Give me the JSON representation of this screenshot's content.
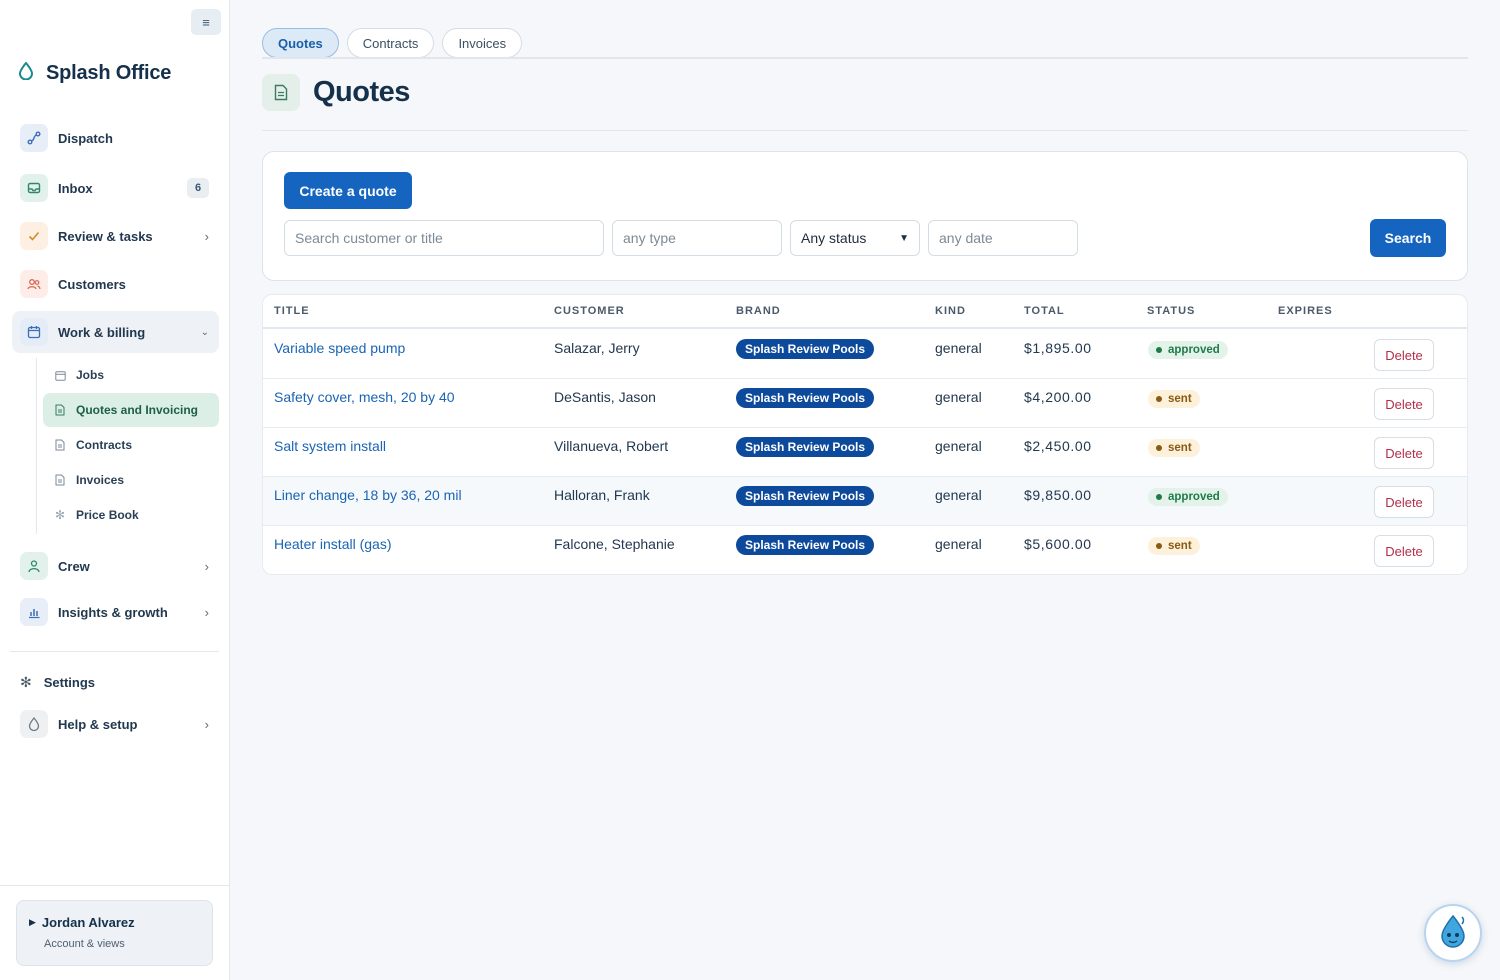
{
  "app": {
    "title": "Splash Office"
  },
  "sidebar": {
    "collapse_icon": "hamburger-icon",
    "nav": [
      {
        "label": "Dispatch",
        "icon": "route-icon",
        "color": "#e7eef7"
      },
      {
        "label": "Inbox",
        "icon": "inbox-icon",
        "badge": "6",
        "color": "#e3f1ec"
      },
      {
        "label": "Review & tasks",
        "icon": "check-icon",
        "color": "#fdf0e2"
      },
      {
        "label": "Customers",
        "icon": "users-icon",
        "color": "#fdece8"
      },
      {
        "label": "Work & billing",
        "icon": "calendar-icon",
        "color": "#e3ecf7"
      },
      {
        "label": "Crew",
        "icon": "person-icon",
        "color": "#e3f1ec"
      },
      {
        "label": "Insights & growth",
        "icon": "chart-icon",
        "color": "#e7eef7"
      },
      {
        "label": "Help & setup",
        "icon": "droplet-icon",
        "color": "#eef0f2"
      }
    ],
    "sub": [
      {
        "label": "Jobs",
        "icon": "calendar-icon"
      },
      {
        "label": "Quotes and Invoicing",
        "icon": "document-icon"
      },
      {
        "label": "Contracts",
        "icon": "document-icon"
      },
      {
        "label": "Invoices",
        "icon": "document-icon"
      },
      {
        "label": "Price Book",
        "icon": "gear-icon"
      }
    ],
    "settings": {
      "label": "Settings",
      "icon": "gear-icon"
    },
    "user": {
      "name": "Jordan Alvarez",
      "subtitle": "Account & views"
    }
  },
  "tabs": [
    "Quotes",
    "Contracts",
    "Invoices"
  ],
  "page": {
    "title": "Quotes",
    "icon": "document-icon"
  },
  "filters": {
    "create_label": "Create a quote",
    "search_placeholder": "Search customer or title",
    "type_placeholder": "any type",
    "status_value": "Any status",
    "date_placeholder": "any date",
    "search_label": "Search"
  },
  "table": {
    "columns": [
      "TITLE",
      "CUSTOMER",
      "BRAND",
      "KIND",
      "TOTAL",
      "STATUS",
      "EXPIRES"
    ],
    "delete_label": "Delete",
    "rows": [
      {
        "title": "Variable speed pump",
        "customer": "Salazar, Jerry",
        "brand": "Splash Review Pools",
        "kind": "general",
        "total": "$1,895.00",
        "status": "approved",
        "expires": ""
      },
      {
        "title": "Safety cover, mesh, 20 by 40",
        "customer": "DeSantis, Jason",
        "brand": "Splash Review Pools",
        "kind": "general",
        "total": "$4,200.00",
        "status": "sent",
        "expires": ""
      },
      {
        "title": "Salt system install",
        "customer": "Villanueva, Robert",
        "brand": "Splash Review Pools",
        "kind": "general",
        "total": "$2,450.00",
        "status": "sent",
        "expires": ""
      },
      {
        "title": "Liner change, 18 by 36, 20 mil",
        "customer": "Halloran, Frank",
        "brand": "Splash Review Pools",
        "kind": "general",
        "total": "$9,850.00",
        "status": "approved",
        "expires": ""
      },
      {
        "title": "Heater install (gas)",
        "customer": "Falcone, Stephanie",
        "brand": "Splash Review Pools",
        "kind": "general",
        "total": "$5,600.00",
        "status": "sent",
        "expires": ""
      }
    ]
  },
  "colors": {
    "accent": "#1565c0",
    "brand_pill": "#0d4a9c",
    "active_green": "#dcefe6"
  },
  "chat": {
    "icon": "droplet-mascot-icon"
  }
}
